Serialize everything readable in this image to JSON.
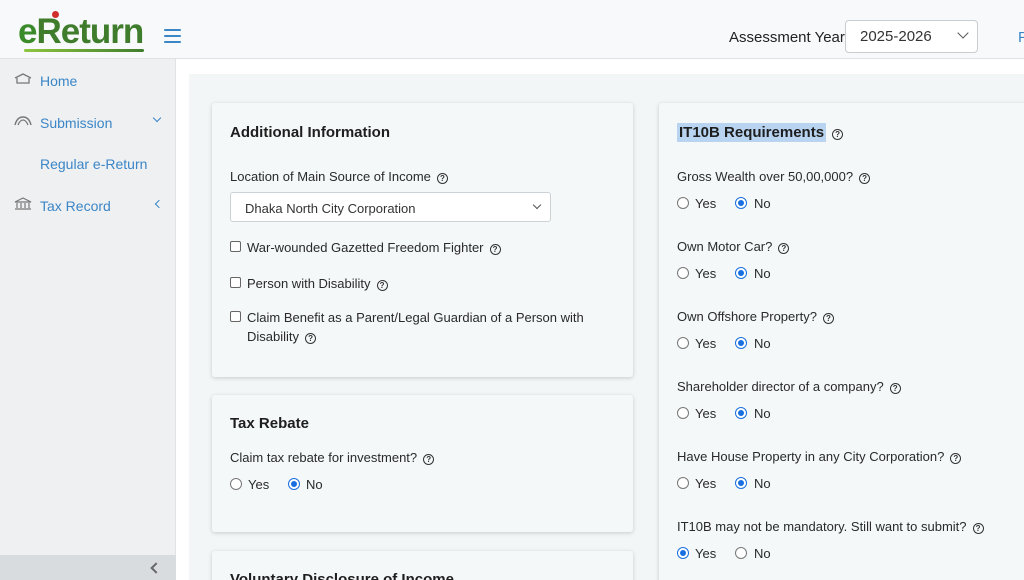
{
  "header": {
    "logo_e": "e",
    "logo_rest": "Return",
    "assessment_year_label": "Assessment Year",
    "assessment_year_value": "2025-2026",
    "right_text": "F"
  },
  "sidebar": {
    "items": [
      {
        "label": "Home",
        "icon": "home-icon"
      },
      {
        "label": "Submission",
        "icon": "submission-icon"
      },
      {
        "label": "Regular e-Return"
      },
      {
        "label": "Tax Record",
        "icon": "bank-icon"
      }
    ]
  },
  "additional_info": {
    "title": "Additional Information",
    "location_label": "Location of Main Source of Income",
    "location_value": "Dhaka North City Corporation",
    "checkboxes": [
      {
        "label": "War-wounded Gazetted Freedom Fighter",
        "checked": false
      },
      {
        "label": "Person with Disability",
        "checked": false
      },
      {
        "label_line1": "Claim Benefit as a Parent/Legal Guardian of a Person with",
        "label_line2": "Disability",
        "checked": false
      }
    ]
  },
  "tax_rebate": {
    "title": "Tax Rebate",
    "question": "Claim tax rebate for investment?",
    "yes": "Yes",
    "no": "No",
    "selected": "No"
  },
  "voluntary": {
    "title": "Voluntary Disclosure of Income"
  },
  "it10b": {
    "title": "IT10B Requirements",
    "questions": [
      {
        "label": "Gross Wealth over 50,00,000?",
        "selected": "No"
      },
      {
        "label": "Own Motor Car?",
        "selected": "No"
      },
      {
        "label": "Own Offshore Property?",
        "selected": "No"
      },
      {
        "label": "Shareholder director of a company?",
        "selected": "No"
      },
      {
        "label": "Have House Property in any City Corporation?",
        "selected": "No"
      },
      {
        "label": "IT10B may not be mandatory. Still want to submit?",
        "selected": "Yes"
      }
    ],
    "yes": "Yes",
    "no": "No"
  },
  "help_glyph": "?",
  "colors": {
    "accent": "#3b86c7",
    "radio_selected": "#1a6fe0",
    "logo_green": "#3f7d2c",
    "highlight": "#b9d4f1"
  }
}
